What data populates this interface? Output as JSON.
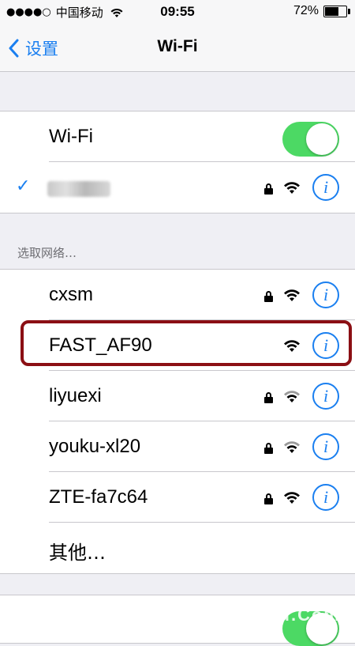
{
  "statusbar": {
    "signal_dots": "●●●●○",
    "carrier": "中国移动",
    "time": "09:55",
    "battery_percent": "72%",
    "battery_level": 0.72
  },
  "navbar": {
    "back_label": "设置",
    "title": "Wi-Fi"
  },
  "wifi_toggle": {
    "label": "Wi-Fi",
    "on": true
  },
  "connected": {
    "checkmark": "✓",
    "name_blurred": true,
    "secured": true
  },
  "section_header": "选取网络…",
  "networks": [
    {
      "name": "cxsm",
      "secured": true
    },
    {
      "name": "FAST_AF90",
      "secured": false
    },
    {
      "name": "liyuexi",
      "secured": true
    },
    {
      "name": "youku-xl20",
      "secured": true
    },
    {
      "name": "ZTE-fa7c64",
      "secured": true
    },
    {
      "name": "其他…",
      "other": true
    }
  ],
  "info_glyph": "i",
  "watermark": "Www.Tenyu.Com",
  "colors": {
    "accent": "#1a7ff0",
    "toggle_on": "#4cd964",
    "highlight": "#8b0f14",
    "background": "#efeff4"
  }
}
